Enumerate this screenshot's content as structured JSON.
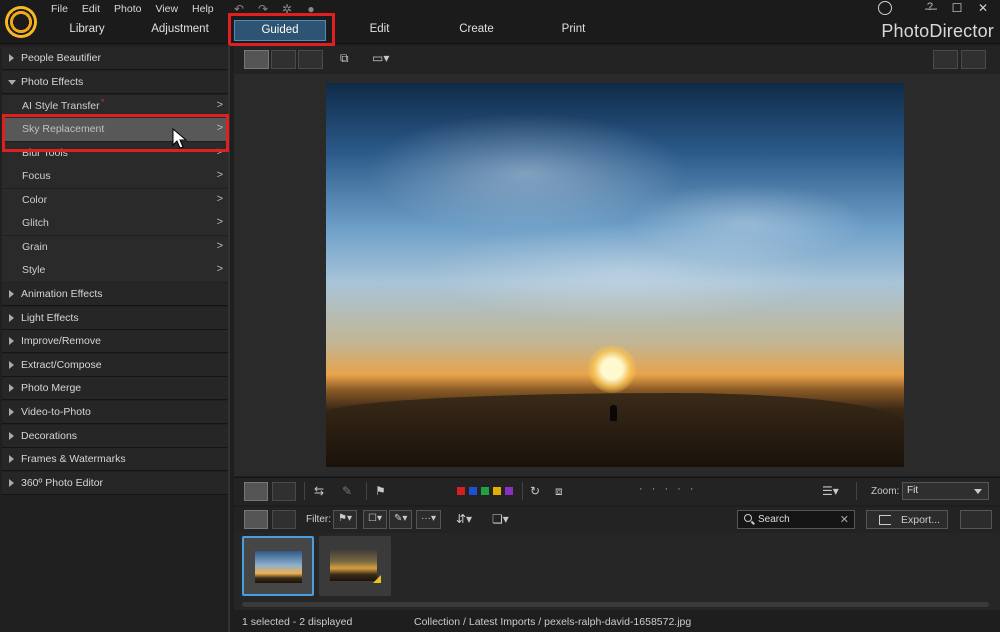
{
  "app": {
    "brand": "PhotoDirector"
  },
  "menu": [
    "File",
    "Edit",
    "Photo",
    "View",
    "Help"
  ],
  "main_tabs": {
    "library": "Library",
    "adjustment": "Adjustment"
  },
  "mode_tabs": [
    {
      "label": "Guided",
      "active": true
    },
    {
      "label": "Edit",
      "active": false
    },
    {
      "label": "Create",
      "active": false
    },
    {
      "label": "Print",
      "active": false
    }
  ],
  "window_controls": {
    "help": "?",
    "minimize": "—",
    "maximize": "☐",
    "close": "✕"
  },
  "left_panel": {
    "categories_top": [
      {
        "label": "People Beautifier",
        "open": false
      },
      {
        "label": "Photo Effects",
        "open": true
      }
    ],
    "photo_effects_items": [
      {
        "label": "AI Style Transfer",
        "new": true,
        "new_mark": "*"
      },
      {
        "label": "Sky Replacement",
        "selected": true
      },
      {
        "label": "Blur Tools"
      },
      {
        "label": "Focus"
      },
      {
        "label": "Color"
      },
      {
        "label": "Glitch"
      },
      {
        "label": "Grain"
      },
      {
        "label": "Style"
      }
    ],
    "categories_bottom": [
      {
        "label": "Animation Effects"
      },
      {
        "label": "Light Effects"
      },
      {
        "label": "Improve/Remove"
      },
      {
        "label": "Extract/Compose"
      },
      {
        "label": "Photo Merge"
      },
      {
        "label": "Video-to-Photo"
      },
      {
        "label": "Decorations"
      },
      {
        "label": "Frames & Watermarks"
      },
      {
        "label": "360º Photo Editor"
      }
    ]
  },
  "viewer_toolbar": {
    "icons": [
      "single-view-icon",
      "compare-view-icon",
      "grid-view-icon",
      "rotate-display-icon",
      "monitor-icon",
      "magnifier-icon",
      "hand-icon"
    ]
  },
  "bottom_toolbar": {
    "color_labels": [
      "#d42020",
      "#2050d0",
      "#20a040",
      "#e0b000",
      "#8a30c0"
    ],
    "zoom_label": "Zoom:",
    "zoom_value": "Fit"
  },
  "filter_bar": {
    "filter_label": "Filter:",
    "search_placeholder": "Search",
    "export_label": "Export..."
  },
  "filmstrip": {
    "thumbs": [
      {
        "name": "pexels-ralph-david-1658572.jpg",
        "selected": true
      },
      {
        "name": "second-photo",
        "selected": false,
        "flag": true
      }
    ]
  },
  "status": {
    "left": "1 selected - 2 displayed",
    "right": "Collection / Latest Imports / pexels-ralph-david-1658572.jpg"
  }
}
